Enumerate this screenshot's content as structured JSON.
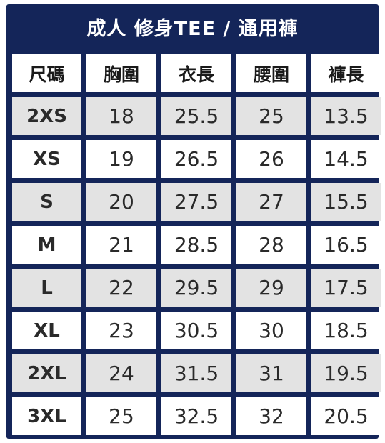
{
  "title": "成人 修身TEE / 通用褲",
  "headers": [
    "尺碼",
    "胸圍",
    "衣長",
    "腰圍",
    "褲長"
  ],
  "rows": [
    {
      "size": "2XS",
      "chest": "18",
      "length": "25.5",
      "waist": "25",
      "pants_length": "13.5",
      "shaded": true
    },
    {
      "size": "XS",
      "chest": "19",
      "length": "26.5",
      "waist": "26",
      "pants_length": "14.5",
      "shaded": false
    },
    {
      "size": "S",
      "chest": "20",
      "length": "27.5",
      "waist": "27",
      "pants_length": "15.5",
      "shaded": true
    },
    {
      "size": "M",
      "chest": "21",
      "length": "28.5",
      "waist": "28",
      "pants_length": "16.5",
      "shaded": false
    },
    {
      "size": "L",
      "chest": "22",
      "length": "29.5",
      "waist": "29",
      "pants_length": "17.5",
      "shaded": true
    },
    {
      "size": "XL",
      "chest": "23",
      "length": "30.5",
      "waist": "30",
      "pants_length": "18.5",
      "shaded": false
    },
    {
      "size": "2XL",
      "chest": "24",
      "length": "31.5",
      "waist": "31",
      "pants_length": "19.5",
      "shaded": true
    },
    {
      "size": "3XL",
      "chest": "25",
      "length": "32.5",
      "waist": "32",
      "pants_length": "20.5",
      "shaded": false
    }
  ],
  "colors": {
    "frame": "#142559",
    "shaded_row": "#e3e3e3",
    "plain_row": "#ffffff"
  }
}
